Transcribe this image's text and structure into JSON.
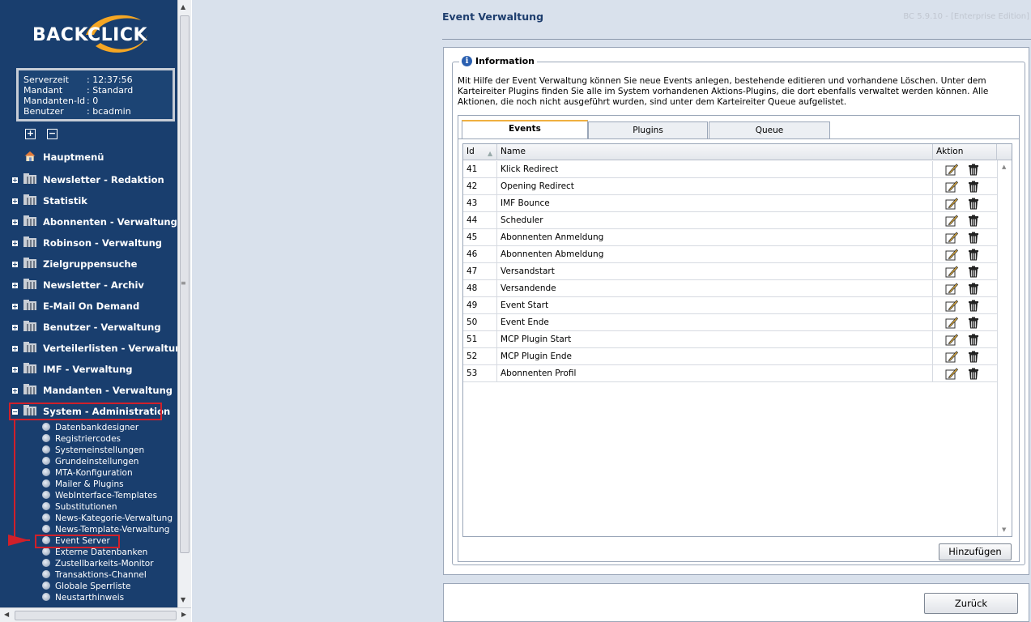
{
  "app": {
    "logo_text": "BACKCLICK",
    "version": "BC 5.9.10 - [Enterprise Edition]"
  },
  "session": {
    "rows": [
      {
        "key": "Serverzeit",
        "value": ": 12:37:56"
      },
      {
        "key": "Mandant",
        "value": ": Standard"
      },
      {
        "key": "Mandanten-Id",
        "value": ": 0"
      },
      {
        "key": "Benutzer",
        "value": ": bcadmin"
      }
    ]
  },
  "sidebar": {
    "expand_symbol": "+",
    "collapse_symbol": "−",
    "home_label": "Hauptmenü",
    "items": [
      {
        "label": "Newsletter - Redaktion",
        "state": "+"
      },
      {
        "label": "Statistik",
        "state": "+"
      },
      {
        "label": "Abonnenten - Verwaltung",
        "state": "+"
      },
      {
        "label": "Robinson - Verwaltung",
        "state": "+"
      },
      {
        "label": "Zielgruppensuche",
        "state": "+"
      },
      {
        "label": "Newsletter - Archiv",
        "state": "+"
      },
      {
        "label": "E-Mail On Demand",
        "state": "+"
      },
      {
        "label": "Benutzer - Verwaltung",
        "state": "+"
      },
      {
        "label": "Verteilerlisten - Verwaltung",
        "state": "+"
      },
      {
        "label": "IMF - Verwaltung",
        "state": "+"
      },
      {
        "label": "Mandanten - Verwaltung",
        "state": "+"
      },
      {
        "label": "System - Administration",
        "state": "−"
      }
    ],
    "subitems": [
      "Datenbankdesigner",
      "Registriercodes",
      "Systemeinstellungen",
      "Grundeinstellungen",
      "MTA-Konfiguration",
      "Mailer & Plugins",
      "WebInterface-Templates",
      "Substitutionen",
      "News-Kategorie-Verwaltung",
      "News-Template-Verwaltung",
      "Event Server",
      "Externe Datenbanken",
      "Zustellbarkeits-Monitor",
      "Transaktions-Channel",
      "Globale Sperrliste",
      "Neustarthinweis"
    ],
    "highlight_color": "#d0202a"
  },
  "main": {
    "title": "Event Verwaltung",
    "info": {
      "legend": "Information",
      "icon": "i",
      "text": "Mit Hilfe der Event Verwaltung können Sie neue Events anlegen, bestehende editieren und vorhandene Löschen. Unter dem Karteireiter Plugins finden Sie alle im System vorhandenen Aktions-Plugins, die dort ebenfalls verwaltet werden können. Alle Aktionen, die noch nicht ausgeführt wurden, sind unter dem Karteireiter Queue aufgelistet."
    },
    "tabs": [
      "Events",
      "Plugins",
      "Queue"
    ],
    "active_tab": "Events",
    "grid": {
      "columns": [
        "Id",
        "Name",
        "Aktion"
      ],
      "rows": [
        {
          "id": "41",
          "name": "Klick Redirect"
        },
        {
          "id": "42",
          "name": "Opening Redirect"
        },
        {
          "id": "43",
          "name": "IMF Bounce"
        },
        {
          "id": "44",
          "name": "Scheduler"
        },
        {
          "id": "45",
          "name": "Abonnenten Anmeldung"
        },
        {
          "id": "46",
          "name": "Abonnenten Abmeldung"
        },
        {
          "id": "47",
          "name": "Versandstart"
        },
        {
          "id": "48",
          "name": "Versandende"
        },
        {
          "id": "49",
          "name": "Event Start"
        },
        {
          "id": "50",
          "name": "Event Ende"
        },
        {
          "id": "51",
          "name": "MCP Plugin Start"
        },
        {
          "id": "52",
          "name": "MCP Plugin Ende"
        },
        {
          "id": "53",
          "name": "Abonnenten Profil"
        }
      ],
      "row_icons": [
        "edit-icon",
        "trash-icon"
      ]
    },
    "add_button": "Hinzufügen",
    "back_button": "Zurück"
  },
  "colors": {
    "sidebar_bg": "#193e6e",
    "main_bg": "#d9e1ec",
    "title": "#1e3e6e",
    "tab_accent": "#f0b040"
  }
}
